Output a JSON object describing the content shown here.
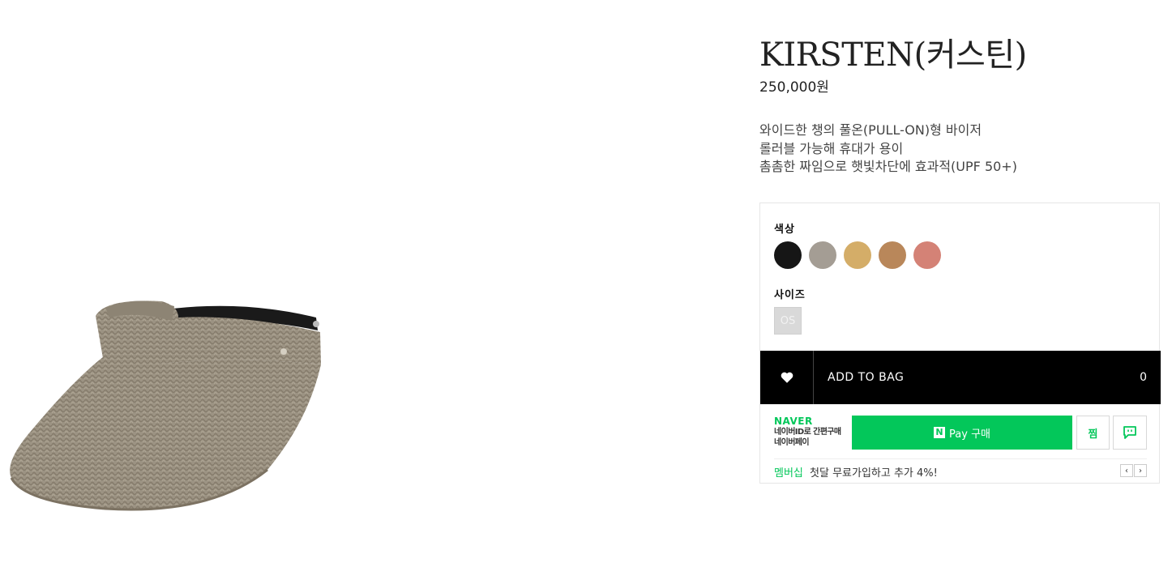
{
  "product": {
    "name": "KIRSTEN(커스틴)",
    "price": "250,000원",
    "description": [
      "와이드한 챙의 풀온(PULL-ON)형 바이저",
      "롤러블 가능해 휴대가 용이",
      "촘촘한 짜임으로 햇빛차단에 효과적(UPF 50+)"
    ]
  },
  "options": {
    "color_label": "색상",
    "colors": [
      {
        "name": "black",
        "hex": "#161616"
      },
      {
        "name": "grey",
        "hex": "#a49d94"
      },
      {
        "name": "natural",
        "hex": "#d4ad68"
      },
      {
        "name": "camel",
        "hex": "#b9875a"
      },
      {
        "name": "rose",
        "hex": "#d48276"
      }
    ],
    "size_label": "사이즈",
    "sizes": [
      "OS"
    ]
  },
  "cart": {
    "add_to_bag_label": "ADD TO BAG",
    "count": "0",
    "wish_icon": "heart-icon"
  },
  "naver_pay": {
    "brand": "NAVER",
    "sub_line1": "네이버ID로 간편구매",
    "sub_line2": "네이버페이",
    "pay_label": "Pay 구매",
    "n_mark": "N",
    "jjim_label": "찜",
    "talk_icon": "talk-icon",
    "accent": "#03c75a"
  },
  "membership": {
    "tag": "멤버십",
    "text": "첫달 무료가입하고 추가 4%!",
    "prev": "‹",
    "next": "›"
  }
}
